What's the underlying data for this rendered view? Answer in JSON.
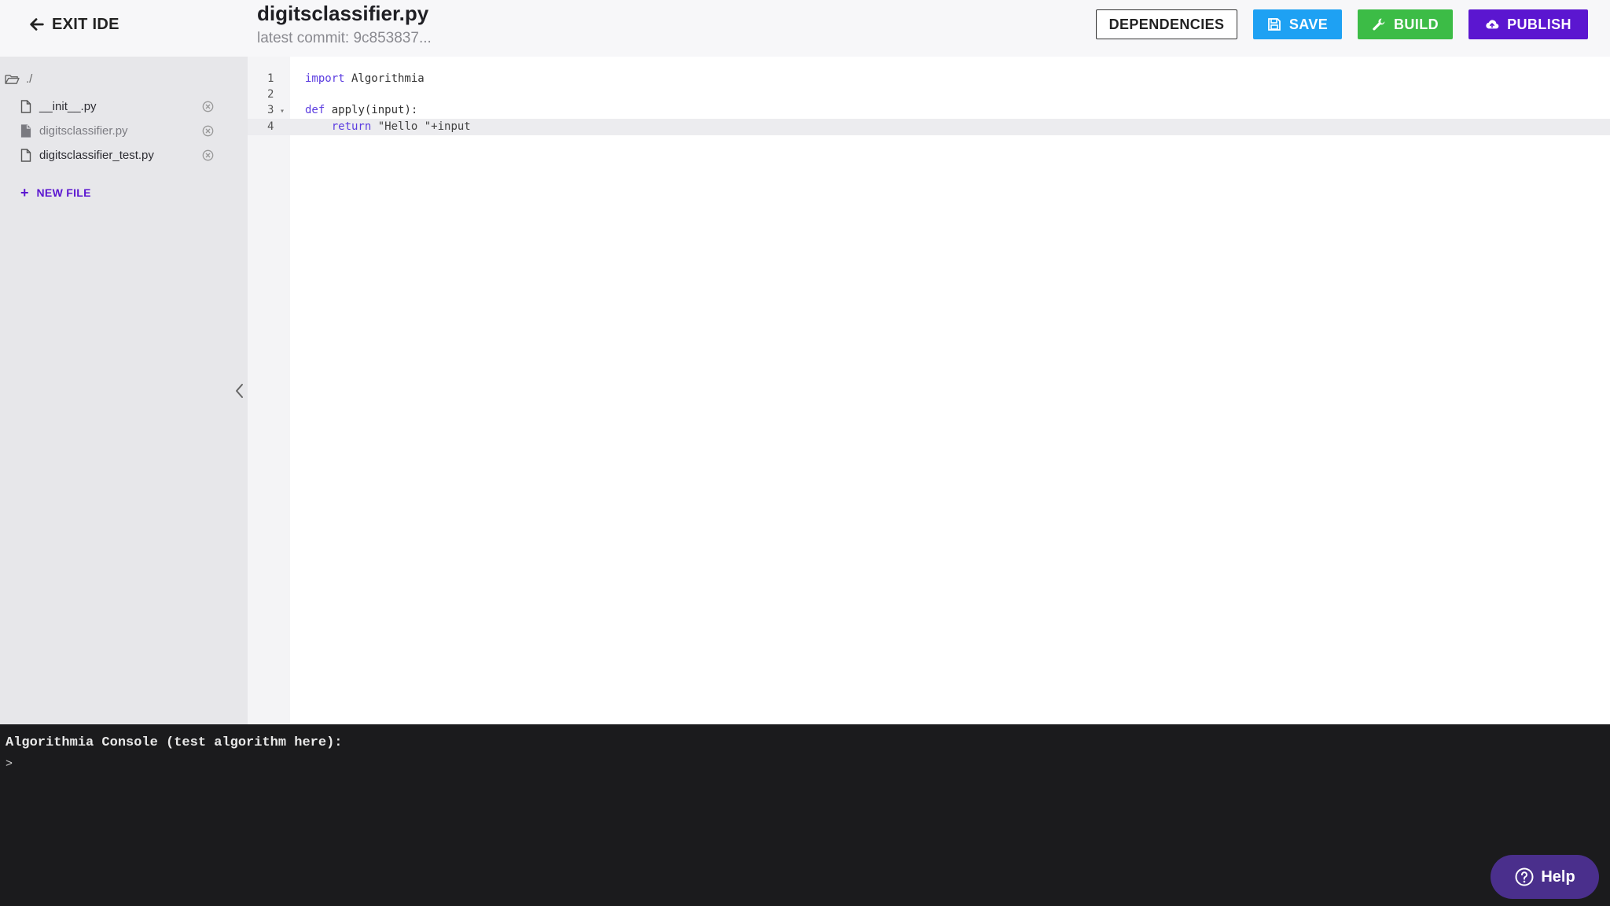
{
  "header": {
    "exit_label": "EXIT IDE",
    "file_title": "digitsclassifier.py",
    "commit_text": "latest commit: 9c853837...",
    "dependencies_label": "DEPENDENCIES",
    "save_label": "SAVE",
    "build_label": "BUILD",
    "publish_label": "PUBLISH"
  },
  "sidebar": {
    "root_label": "./",
    "files": [
      {
        "name": "__init__.py",
        "active": false
      },
      {
        "name": "digitsclassifier.py",
        "active": true
      },
      {
        "name": "digitsclassifier_test.py",
        "active": false
      }
    ],
    "new_file_label": "NEW FILE"
  },
  "editor": {
    "line_numbers": [
      "1",
      "2",
      "3",
      "4"
    ],
    "lines": {
      "l1_kw": "import",
      "l1_rest": " Algorithmia",
      "l3_kw": "def",
      "l3_rest": " apply(input):",
      "l4_indent": "    ",
      "l4_kw": "return",
      "l4_rest": " \"Hello \"+input"
    }
  },
  "console": {
    "title": "Algorithmia Console (test algorithm here):",
    "prompt": ">"
  },
  "help": {
    "label": "Help"
  },
  "colors": {
    "save": "#1ea1f3",
    "build": "#3cbc46",
    "publish": "#5b16d0",
    "console_bg": "#1b1b1d",
    "help_bg": "#4a2f8c"
  }
}
